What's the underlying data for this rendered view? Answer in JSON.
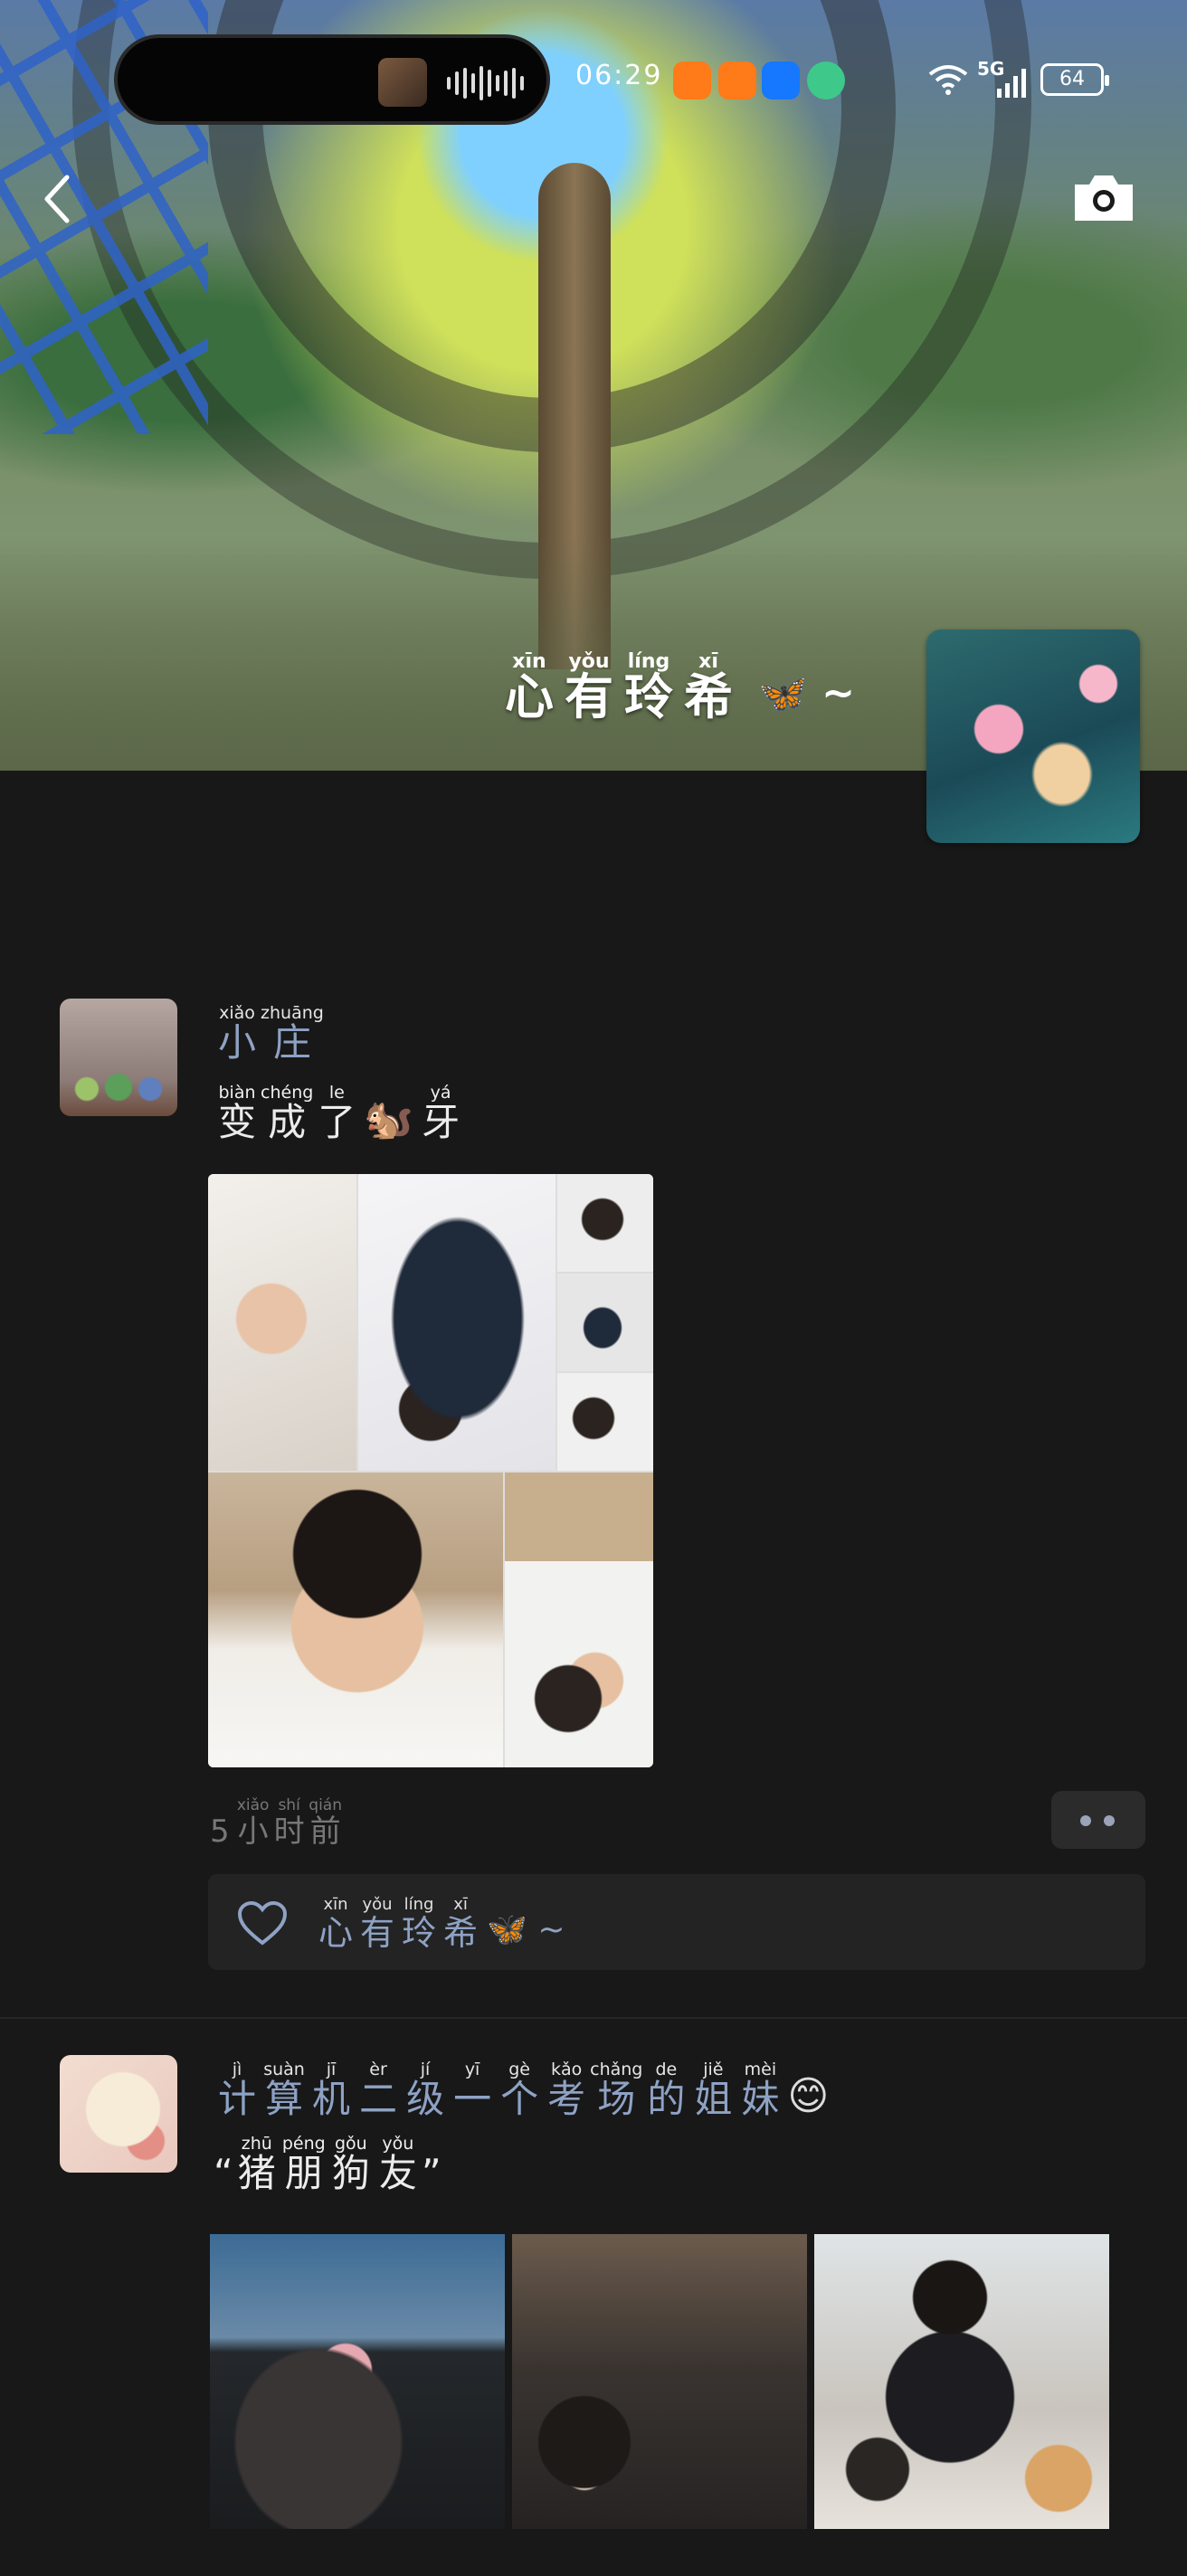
{
  "status_bar": {
    "time": "06:29",
    "network": "5G",
    "battery": "64",
    "app_icons": [
      "taobao-icon",
      "taobao-icon",
      "alipay-icon",
      "wechat-icon"
    ]
  },
  "cover": {
    "name": [
      {
        "hz": "心",
        "py": "xīn"
      },
      {
        "hz": "有",
        "py": "yǒu"
      },
      {
        "hz": "玲",
        "py": "líng"
      },
      {
        "hz": "希",
        "py": "xī"
      }
    ],
    "name_suffix": "🦋 ~"
  },
  "posts": [
    {
      "user": [
        {
          "hz": "小",
          "py": "xiǎo"
        },
        {
          "hz": "庄",
          "py": "zhuāng"
        }
      ],
      "text": [
        {
          "hz": "变",
          "py": "biàn"
        },
        {
          "hz": "成",
          "py": "chéng"
        },
        {
          "hz": "了",
          "py": "le"
        },
        {
          "emoji": "🐿️"
        },
        {
          "hz": "牙",
          "py": "yá"
        }
      ],
      "time_num": "5",
      "time_unit": [
        {
          "hz": "小",
          "py": "xiǎo"
        },
        {
          "hz": "时",
          "py": "shí"
        },
        {
          "hz": "前",
          "py": "qián"
        }
      ],
      "likes": [
        {
          "hz": "心",
          "py": "xīn"
        },
        {
          "hz": "有",
          "py": "yǒu"
        },
        {
          "hz": "玲",
          "py": "líng"
        },
        {
          "hz": "希",
          "py": "xī"
        }
      ],
      "likes_suffix": "🦋 ~"
    },
    {
      "user": [
        {
          "hz": "计",
          "py": "jì"
        },
        {
          "hz": "算",
          "py": "suàn"
        },
        {
          "hz": "机",
          "py": "jī"
        },
        {
          "hz": "二",
          "py": "èr"
        },
        {
          "hz": "级",
          "py": "jí"
        },
        {
          "hz": "一",
          "py": "yī"
        },
        {
          "hz": "个",
          "py": "gè"
        },
        {
          "hz": "考",
          "py": "kǎo"
        },
        {
          "hz": "场",
          "py": "chǎng"
        },
        {
          "hz": "的",
          "py": "de"
        },
        {
          "hz": "姐",
          "py": "jiě"
        },
        {
          "hz": "妹",
          "py": "mèi"
        }
      ],
      "user_emoji": "😊",
      "text_open": "“",
      "text": [
        {
          "hz": "猪",
          "py": "zhū"
        },
        {
          "hz": "朋",
          "py": "péng"
        },
        {
          "hz": "狗",
          "py": "gǒu"
        },
        {
          "hz": "友",
          "py": "yǒu"
        }
      ],
      "text_close": "”"
    }
  ]
}
